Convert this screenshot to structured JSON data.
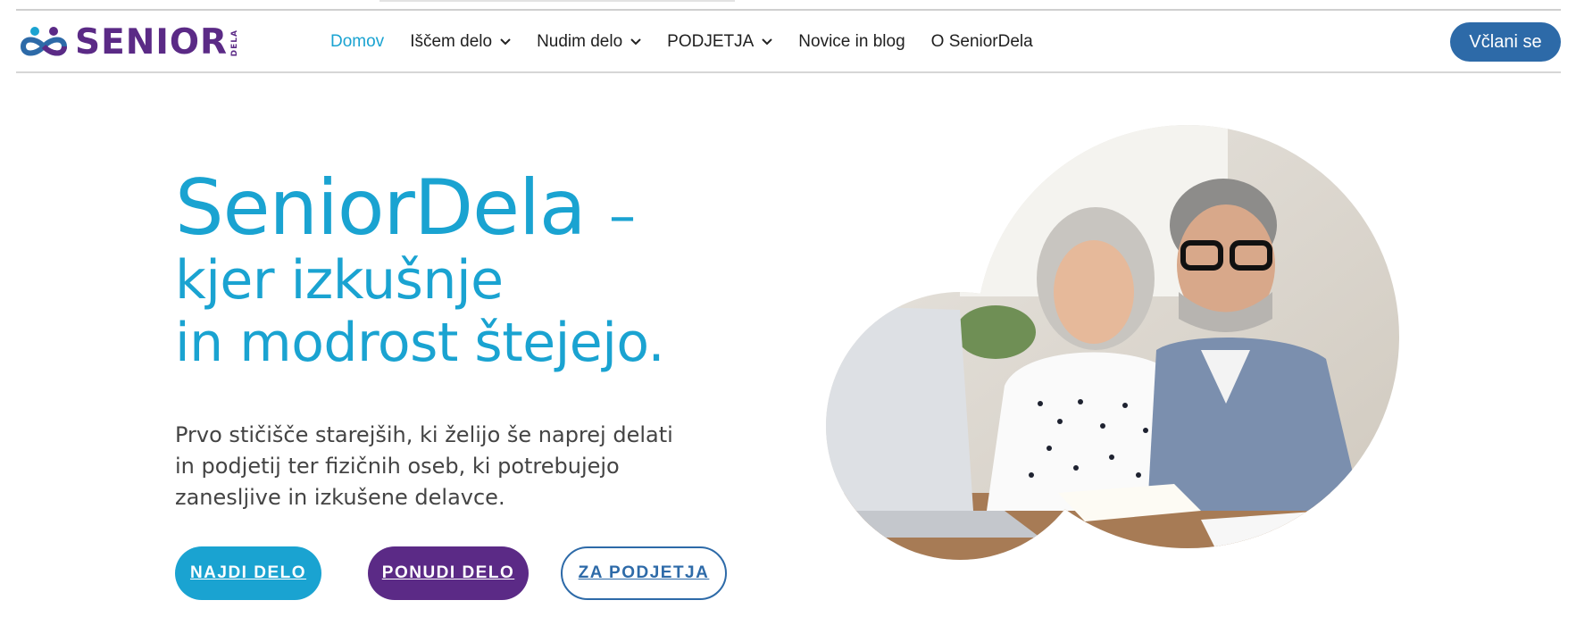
{
  "brand": {
    "logo_text": "SENIOR",
    "logo_sub": "DELA",
    "primary_color": "#1aa3d1",
    "secondary_color": "#5b2a86",
    "button_blue": "#2d6aa8"
  },
  "nav": {
    "items": [
      {
        "label": "Domov",
        "active": true,
        "dropdown": false
      },
      {
        "label": "Iščem delo",
        "active": false,
        "dropdown": true
      },
      {
        "label": "Nudim delo",
        "active": false,
        "dropdown": true
      },
      {
        "label": "PODJETJA",
        "active": false,
        "dropdown": true
      },
      {
        "label": "Novice in blog",
        "active": false,
        "dropdown": false
      },
      {
        "label": "O SeniorDela",
        "active": false,
        "dropdown": false
      }
    ],
    "join_label": "Včlani se"
  },
  "hero": {
    "title": "SeniorDela",
    "title_dash": "–",
    "subtitle_line1": "kjer izkušnje",
    "subtitle_line2": "in modrost štejejo.",
    "text_line1": "Prvo stičišče starejših, ki želijo še naprej delati",
    "text_line2": "in podjetij ter fizičnih oseb, ki potrebujejo",
    "text_line3": "zanesljive in izkušene delavce.",
    "buttons": {
      "find": "NAJDI DELO",
      "offer": "PONUDI DELO",
      "companies": "ZA PODJETJA"
    }
  }
}
